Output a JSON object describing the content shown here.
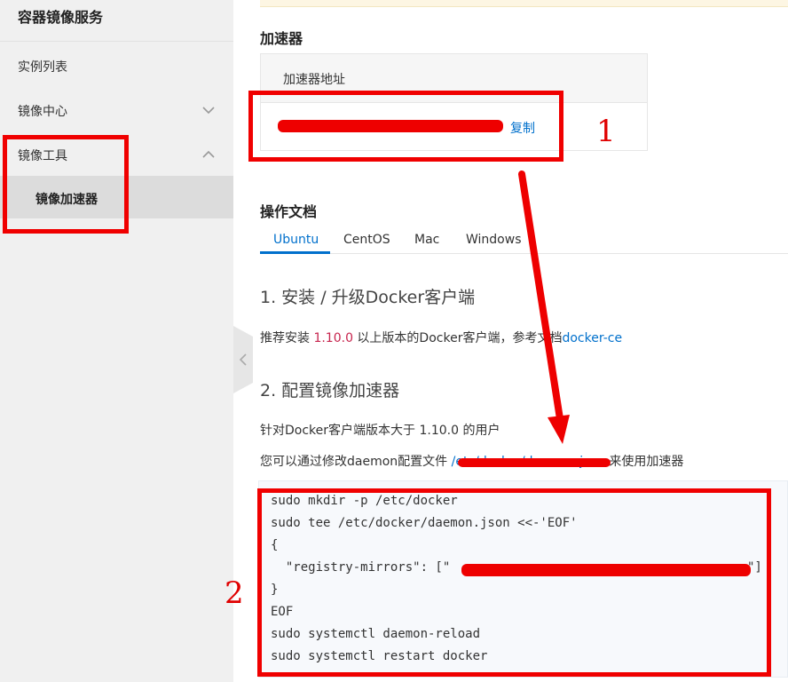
{
  "sidebar": {
    "title": "容器镜像服务",
    "items": [
      {
        "label": "实例列表"
      },
      {
        "label": "镜像中心",
        "icon": "chevron-down-icon"
      },
      {
        "label": "镜像工具",
        "icon": "chevron-up-icon"
      }
    ],
    "sub_items": [
      {
        "label": "镜像加速器",
        "selected": true
      }
    ],
    "collapse_icon": "chevron-left-icon"
  },
  "accelerator": {
    "heading": "加速器",
    "address_header": "加速器地址",
    "copy_label": "复制"
  },
  "docs": {
    "heading": "操作文档",
    "tabs": [
      {
        "label": "Ubuntu",
        "active": true
      },
      {
        "label": "CentOS"
      },
      {
        "label": "Mac"
      },
      {
        "label": "Windows"
      }
    ],
    "step1_title": "1. 安装 / 升级Docker客户端",
    "step1_text_before": "推荐安装 ",
    "step1_version": "1.10.0",
    "step1_text_after": " 以上版本的Docker客户端，参考文档",
    "step1_link": "docker-ce",
    "step2_title": "2. 配置镜像加速器",
    "step2_line1": "针对Docker客户端版本大于 1.10.0 的用户",
    "step2_line2_before": "您可以通过修改daemon配置文件 ",
    "step2_line2_path": "/etc/docker/daemon.json",
    "step2_line2_after": " 来使用加速器"
  },
  "code": {
    "lines": [
      "sudo mkdir -p /etc/docker",
      "sudo tee /etc/docker/daemon.json <<-'EOF'",
      "{",
      "  \"registry-mirrors\": [\"",
      "}",
      "EOF",
      "sudo systemctl daemon-reload",
      "sudo systemctl restart docker"
    ],
    "mirror_close": "\"]"
  },
  "annotations": {
    "label_1": "1",
    "label_2": "2",
    "color": "#ee0000"
  }
}
